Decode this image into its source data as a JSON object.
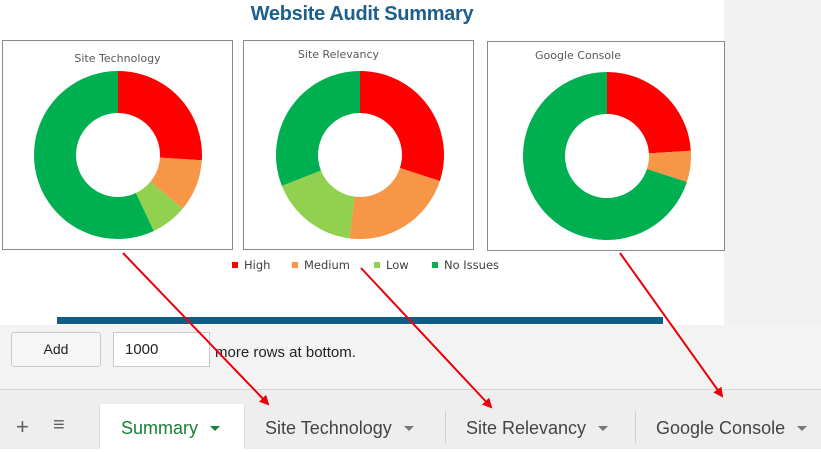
{
  "report": {
    "title": "Website Audit Summary"
  },
  "chart_data": [
    {
      "type": "pie",
      "title": "Site Technology",
      "categories": [
        "High",
        "Medium",
        "Low",
        "No Issues"
      ],
      "values": [
        26,
        10,
        7,
        57
      ],
      "colors": [
        "#ff0000",
        "#f79646",
        "#92d050",
        "#00b050"
      ]
    },
    {
      "type": "pie",
      "title": "Site Relevancy",
      "categories": [
        "High",
        "Medium",
        "Low",
        "No Issues"
      ],
      "values": [
        30,
        22,
        17,
        31
      ],
      "colors": [
        "#ff0000",
        "#f79646",
        "#92d050",
        "#00b050"
      ]
    },
    {
      "type": "pie",
      "title": "Google Console",
      "categories": [
        "High",
        "Medium",
        "Low",
        "No Issues"
      ],
      "values": [
        24,
        6,
        0,
        70
      ],
      "colors": [
        "#ff0000",
        "#f79646",
        "#92d050",
        "#00b050"
      ]
    }
  ],
  "legend": {
    "items": [
      {
        "label": "High",
        "color": "#ff0000"
      },
      {
        "label": "Medium",
        "color": "#f79646"
      },
      {
        "label": "Low",
        "color": "#92d050"
      },
      {
        "label": "No Issues",
        "color": "#00b050"
      }
    ]
  },
  "add_rows": {
    "button_label": "Add",
    "count": "1000",
    "suffix": "more rows at bottom."
  },
  "toolbar": {
    "add_sheet_icon": "+",
    "all_sheets_icon": "≡"
  },
  "tabs": [
    {
      "label": "Summary",
      "active": true
    },
    {
      "label": "Site Technology",
      "active": false
    },
    {
      "label": "Site Relevancy",
      "active": false
    },
    {
      "label": "Google Console",
      "active": false
    }
  ],
  "colors": {
    "title": "#1b5f8c",
    "accent_bar": "#0c5e87",
    "active_tab": "#188038",
    "arrow": "#e8000b"
  }
}
